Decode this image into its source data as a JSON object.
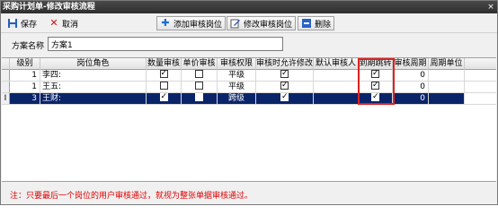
{
  "window": {
    "title": "采购计划单-修改审核流程",
    "close_glyph": "×"
  },
  "toolbar": {
    "save": {
      "label": "保存",
      "icon": "save-icon"
    },
    "cancel": {
      "label": "取消",
      "icon": "cancel-x-icon"
    },
    "add": {
      "label": "添加审核岗位",
      "icon": "plus-icon"
    },
    "edit": {
      "label": "修改审核岗位",
      "icon": "edit-icon"
    },
    "delete": {
      "label": "删除",
      "icon": "minus-icon"
    }
  },
  "scheme": {
    "label": "方案名称",
    "value": "方案1"
  },
  "grid": {
    "columns": [
      "级别",
      "岗位角色",
      "数量审核",
      "单价审核",
      "审核权限",
      "审核时允许修改",
      "默认审核人",
      "到期跳转",
      "审核周期",
      "周期单位"
    ],
    "rows": [
      {
        "indicator": "",
        "level": "1",
        "role": "李四:",
        "qty": true,
        "price": false,
        "perm": "平级",
        "allow": true,
        "default": "",
        "jump": true,
        "cycle": "0",
        "unit": ""
      },
      {
        "indicator": "",
        "level": "1",
        "role": "王五:",
        "qty": false,
        "price": false,
        "perm": "平级",
        "allow": true,
        "default": "",
        "jump": true,
        "cycle": "0",
        "unit": ""
      },
      {
        "indicator": "I",
        "level": "3",
        "role": "王财:",
        "qty": true,
        "price": false,
        "perm": "跨级",
        "allow": true,
        "default": "",
        "jump": true,
        "cycle": "0",
        "unit": "",
        "selected": true
      }
    ]
  },
  "note": "注：只要最后一个岗位的用户审核通过，就视为整张单据审核通过。",
  "colors": {
    "titlebar": "#2e2e2e",
    "selected_row": "#0a246a",
    "highlight_box": "#e02020",
    "note_text": "#e00000"
  }
}
